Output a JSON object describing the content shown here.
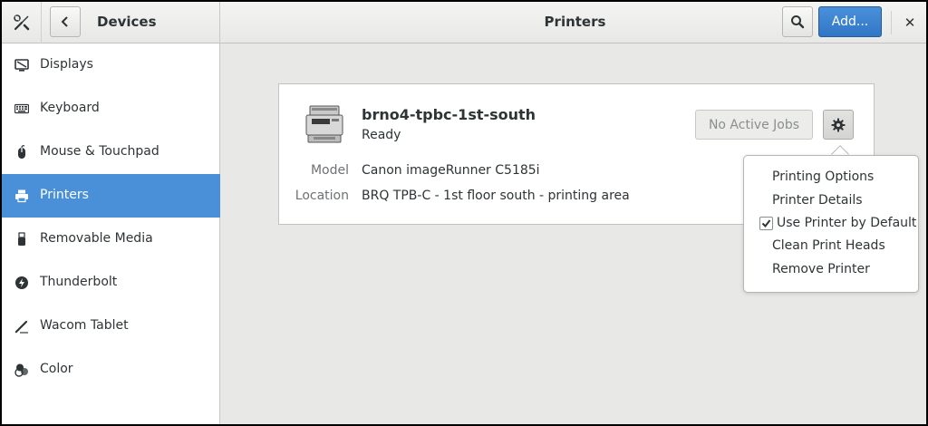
{
  "header": {
    "left_title": "Devices",
    "title": "Printers",
    "add_label": "Add...",
    "close_glyph": "✕"
  },
  "sidebar": {
    "items": [
      {
        "label": "Displays",
        "icon": "display-icon"
      },
      {
        "label": "Keyboard",
        "icon": "keyboard-icon"
      },
      {
        "label": "Mouse & Touchpad",
        "icon": "mouse-icon"
      },
      {
        "label": "Printers",
        "icon": "printer-icon",
        "active": true
      },
      {
        "label": "Removable Media",
        "icon": "usb-icon"
      },
      {
        "label": "Thunderbolt",
        "icon": "thunderbolt-icon"
      },
      {
        "label": "Wacom Tablet",
        "icon": "tablet-icon"
      },
      {
        "label": "Color",
        "icon": "color-icon"
      }
    ]
  },
  "printer": {
    "name": "brno4-tpbc-1st-south",
    "status": "Ready",
    "jobs_label": "No Active Jobs",
    "model_label": "Model",
    "model_value": "Canon imageRunner C5185i",
    "location_label": "Location",
    "location_value": "BRQ TPB-C - 1st floor south - printing area"
  },
  "menu": {
    "items": [
      {
        "label": "Printing Options"
      },
      {
        "label": "Printer Details"
      },
      {
        "label": "Use Printer by Default",
        "checked": true
      },
      {
        "label": "Clean Print Heads"
      },
      {
        "label": "Remove Printer"
      }
    ]
  },
  "colors": {
    "accent": "#4a90d9",
    "sidebar_bg": "#ffffff",
    "main_bg": "#e8e8e7"
  }
}
